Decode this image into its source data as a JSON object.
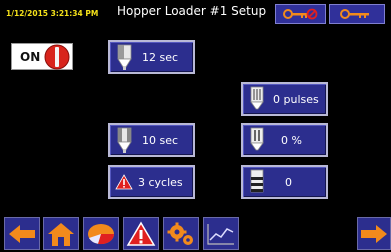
{
  "header": {
    "timestamp": "1/12/2015 3:21:34 PM",
    "title": "Hopper Loader #1 Setup"
  },
  "power_toggle": {
    "label": "ON",
    "state": "on"
  },
  "fields": {
    "load_time": "12 sec",
    "pulses": "0 pulses",
    "dump_time": "10 sec",
    "percent": "0 %",
    "alarm_cycles": "3 cycles",
    "level": "0"
  },
  "colors": {
    "background": "#000000",
    "button_blue": "#2c2e8e",
    "accent_orange": "#f28a1c",
    "timestamp_yellow": "#f5e21a",
    "alarm_red": "#e02020"
  },
  "icons": {
    "header": [
      "key-lock-icon",
      "key-icon"
    ],
    "nav": [
      "back-arrow-icon",
      "home-icon",
      "pie-chart-icon",
      "alarm-icon",
      "settings-gears-icon",
      "trend-chart-icon",
      "next-arrow-icon"
    ]
  }
}
